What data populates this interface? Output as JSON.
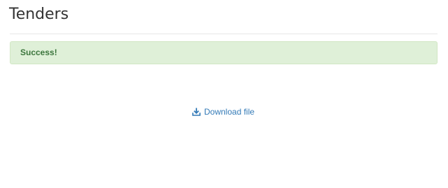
{
  "page": {
    "title": "Tenders"
  },
  "alert": {
    "message": "Success!",
    "status_color": "#3c763d",
    "background_color": "#dff0d8"
  },
  "download": {
    "label": "Download file",
    "icon": "download-icon",
    "link_color": "#337ab7"
  }
}
